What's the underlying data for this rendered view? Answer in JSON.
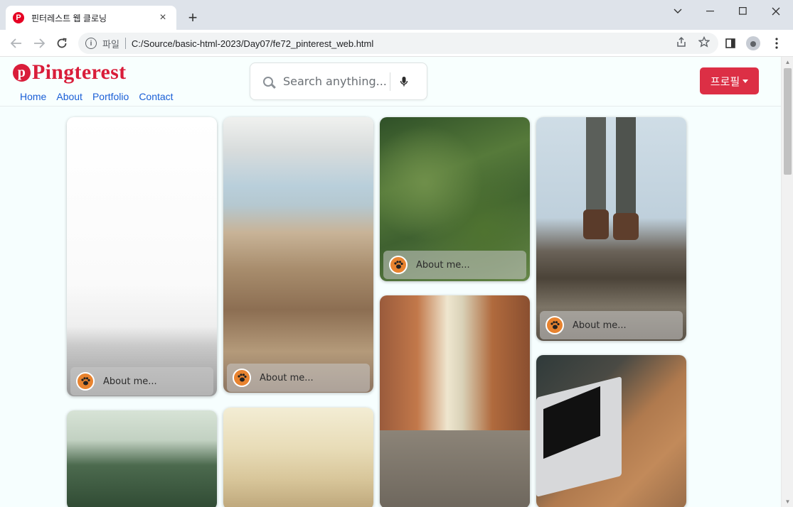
{
  "browser": {
    "tab_title": "핀터레스트 웹 클로닝",
    "favicon_letter": "P",
    "tab_close": "×",
    "new_tab": "+",
    "url_scheme": "파일",
    "url": "C:/Source/basic-html-2023/Day07/fe72_pinterest_web.html"
  },
  "site": {
    "logo_mark": "p",
    "logo_text": "Pingterest",
    "nav": [
      "Home",
      "About",
      "Portfolio",
      "Contact"
    ],
    "search_placeholder": "Search anything...",
    "profile_label": "프로필",
    "brand_color": "#dc2f45"
  },
  "pins": [
    {
      "caption": "About me...",
      "icon": "paw-icon"
    },
    {
      "caption": "About me...",
      "icon": "paw-icon"
    },
    {
      "caption": "About me...",
      "icon": "paw-icon"
    },
    {
      "caption": "About me...",
      "icon": "paw-icon"
    }
  ]
}
